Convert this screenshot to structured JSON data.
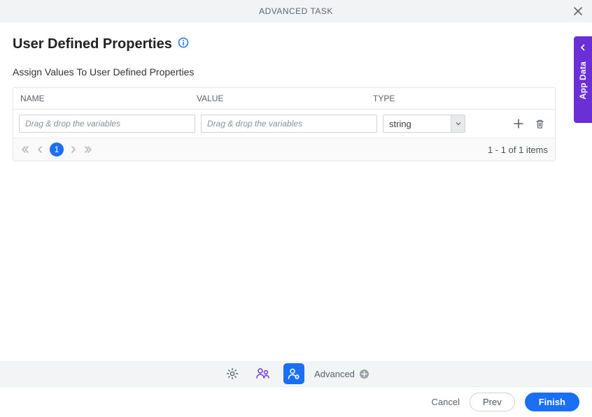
{
  "titlebar": {
    "title": "ADVANCED TASK"
  },
  "page": {
    "title": "User Defined Properties",
    "subtitle": "Assign Values To User Defined Properties"
  },
  "table": {
    "columns": {
      "name": "NAME",
      "value": "VALUE",
      "type": "TYPE"
    },
    "rows": [
      {
        "name_placeholder": "Drag & drop the variables",
        "value_placeholder": "Drag & drop the variables",
        "type_selected": "string"
      }
    ]
  },
  "pager": {
    "current": "1",
    "status": "1 - 1 of 1 items"
  },
  "side_tab": {
    "label": "App Data"
  },
  "toolbar": {
    "advanced_label": "Advanced"
  },
  "footer": {
    "cancel": "Cancel",
    "prev": "Prev",
    "finish": "Finish"
  },
  "colors": {
    "accent": "#1b6ff2",
    "side": "#6b2fd6"
  }
}
